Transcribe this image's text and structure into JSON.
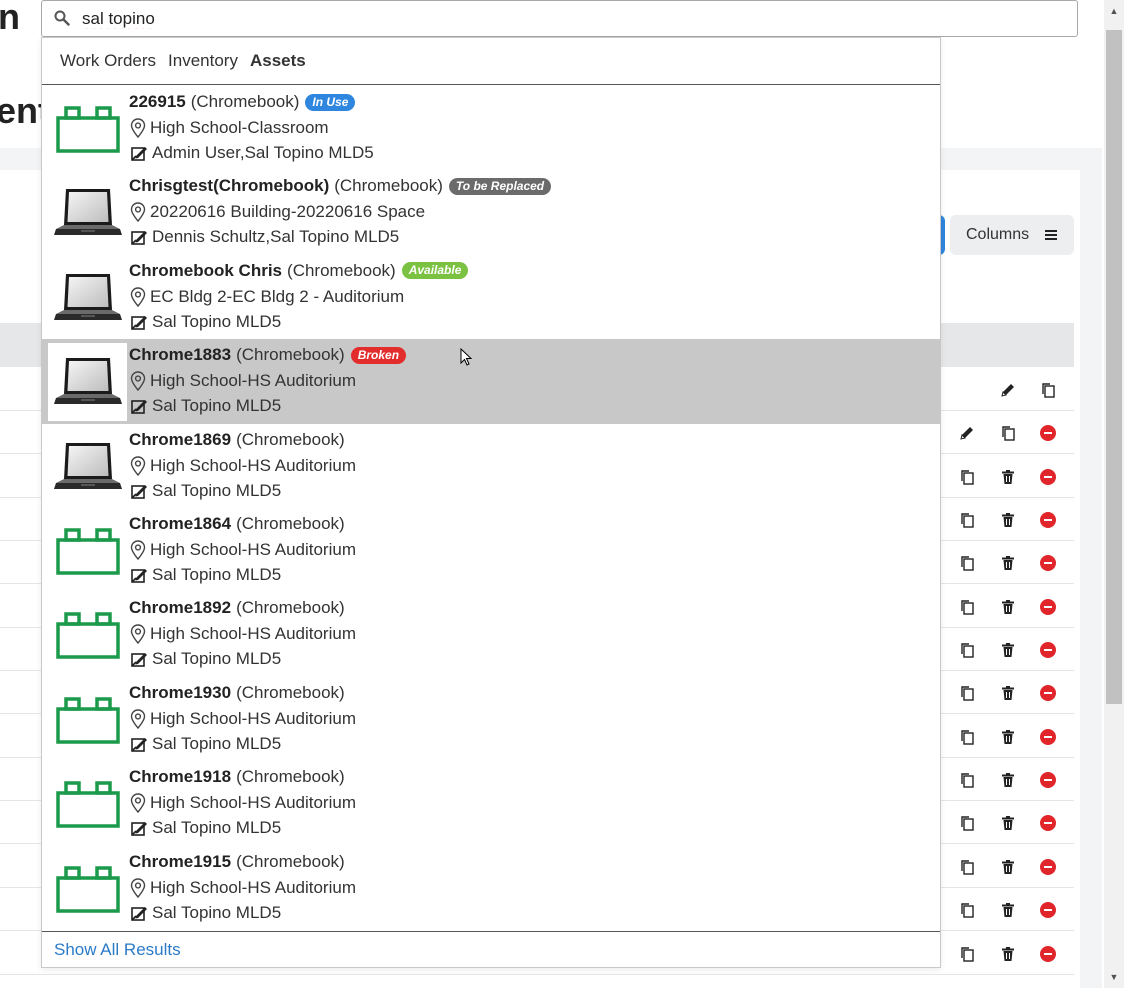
{
  "background": {
    "title_fragment_top": "n",
    "title_fragment_mid": "ent",
    "columns_button_label": "Columns",
    "row_action_icons": [
      "edit-icon",
      "copy-icon",
      "trash-icon",
      "remove-icon"
    ]
  },
  "search": {
    "query": "sal topino"
  },
  "tabs": [
    {
      "label": "Work Orders",
      "active": false
    },
    {
      "label": "Inventory",
      "active": false
    },
    {
      "label": "Assets",
      "active": true
    }
  ],
  "results": [
    {
      "name": "226915",
      "type": "(Chromebook)",
      "badge": "In Use",
      "badge_color": "#2e86de",
      "location": "High School-Classroom",
      "users": "Admin User,Sal Topino MLD5",
      "thumb": "block-icon"
    },
    {
      "name": "Chrisgtest(Chromebook)",
      "type": "(Chromebook)",
      "badge": "To be Replaced",
      "badge_color": "#6b6b6b",
      "location": "20220616 Building-20220616 Space",
      "users": "Dennis Schultz,Sal Topino MLD5",
      "thumb": "laptop-icon"
    },
    {
      "name": "Chromebook Chris",
      "type": "(Chromebook)",
      "badge": "Available",
      "badge_color": "#7cc242",
      "location": "EC Bldg 2-EC Bldg 2 - Auditorium",
      "users": "Sal Topino MLD5",
      "thumb": "laptop-icon"
    },
    {
      "name": "Chrome1883",
      "type": "(Chromebook)",
      "badge": "Broken",
      "badge_color": "#e32c2c",
      "location": "High School-HS Auditorium",
      "users": "Sal Topino MLD5",
      "thumb": "laptop-icon",
      "hover": true
    },
    {
      "name": "Chrome1869",
      "type": "(Chromebook)",
      "badge": "",
      "badge_color": "",
      "location": "High School-HS Auditorium",
      "users": "Sal Topino MLD5",
      "thumb": "laptop-icon"
    },
    {
      "name": "Chrome1864",
      "type": "(Chromebook)",
      "badge": "",
      "badge_color": "",
      "location": "High School-HS Auditorium",
      "users": "Sal Topino MLD5",
      "thumb": "block-icon"
    },
    {
      "name": "Chrome1892",
      "type": "(Chromebook)",
      "badge": "",
      "badge_color": "",
      "location": "High School-HS Auditorium",
      "users": "Sal Topino MLD5",
      "thumb": "block-icon"
    },
    {
      "name": "Chrome1930",
      "type": "(Chromebook)",
      "badge": "",
      "badge_color": "",
      "location": "High School-HS Auditorium",
      "users": "Sal Topino MLD5",
      "thumb": "block-icon"
    },
    {
      "name": "Chrome1918",
      "type": "(Chromebook)",
      "badge": "",
      "badge_color": "",
      "location": "High School-HS Auditorium",
      "users": "Sal Topino MLD5",
      "thumb": "block-icon"
    },
    {
      "name": "Chrome1915",
      "type": "(Chromebook)",
      "badge": "",
      "badge_color": "",
      "location": "High School-HS Auditorium",
      "users": "Sal Topino MLD5",
      "thumb": "block-icon"
    }
  ],
  "show_all_label": "Show All Results",
  "colors": {
    "block_icon": "#1a9a4a",
    "link": "#2a7ac7",
    "hover_row": "#c8c8c8"
  }
}
